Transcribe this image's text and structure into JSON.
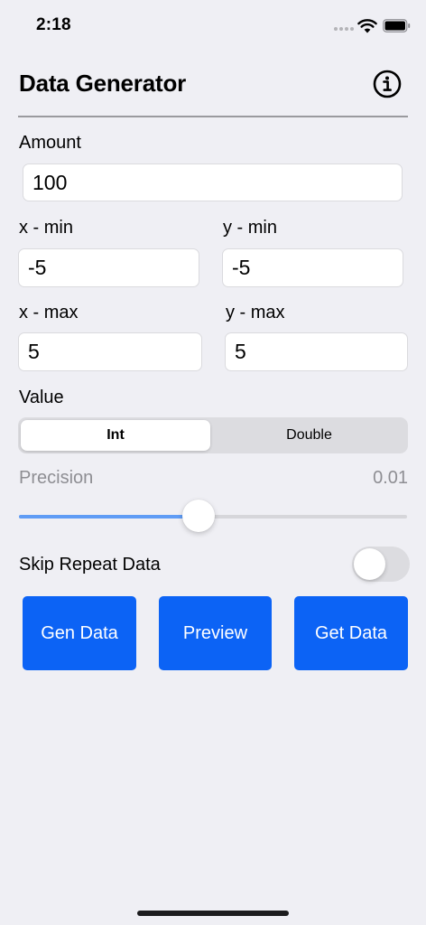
{
  "status_bar": {
    "time": "2:18"
  },
  "header": {
    "title": "Data Generator",
    "info_icon": "info-circle-icon"
  },
  "amount": {
    "label": "Amount",
    "value": "100"
  },
  "x_min": {
    "label": "x - min",
    "value": "-5"
  },
  "y_min": {
    "label": "y - min",
    "value": "-5"
  },
  "x_max": {
    "label": "x - max",
    "value": "5"
  },
  "y_max": {
    "label": "y - max",
    "value": "5"
  },
  "value_type": {
    "label": "Value",
    "options": [
      "Int",
      "Double"
    ],
    "selected": "Int"
  },
  "precision": {
    "label": "Precision",
    "value": "0.01",
    "slider_fraction": 0.46
  },
  "skip_repeat": {
    "label": "Skip Repeat Data",
    "on": false
  },
  "actions": {
    "gen_label": "Gen Data",
    "preview_label": "Preview",
    "get_label": "Get Data"
  },
  "colors": {
    "accent": "#0C63F5",
    "slider_fill": "#5F9CF5",
    "background": "#EFEFF4"
  }
}
